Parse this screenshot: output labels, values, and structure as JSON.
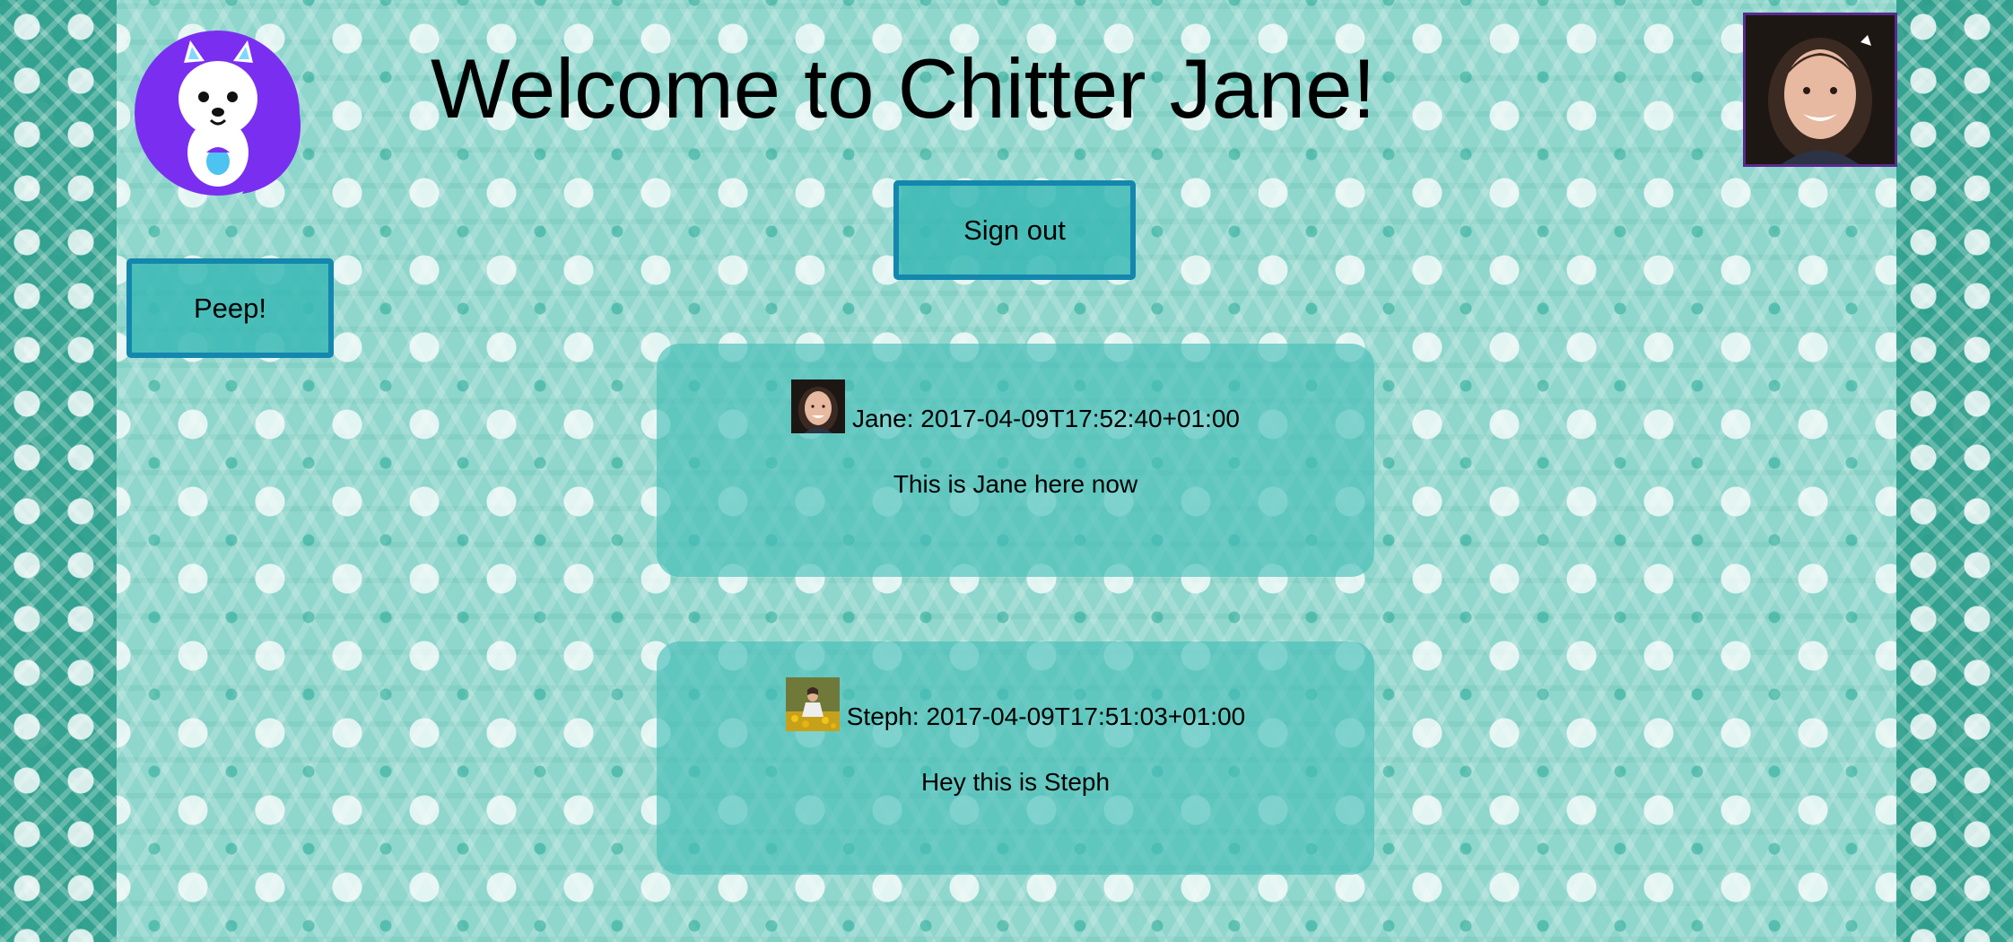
{
  "header": {
    "title": "Welcome to Chitter Jane!"
  },
  "buttons": {
    "sign_out": "Sign out",
    "peep": "Peep!"
  },
  "peeps": [
    {
      "author": "Jane",
      "timestamp": "2017-04-09T17:52:40+01:00",
      "text": "This is Jane here now"
    },
    {
      "author": "Steph",
      "timestamp": "2017-04-09T17:51:03+01:00",
      "text": "Hey this is Steph"
    }
  ],
  "colors": {
    "logo_purple": "#7a2ff0",
    "button_border": "#1487ae",
    "avatar_border": "#5a2a8c"
  },
  "icons": {
    "logo": "squirrel-logo",
    "profile": "user-avatar"
  }
}
